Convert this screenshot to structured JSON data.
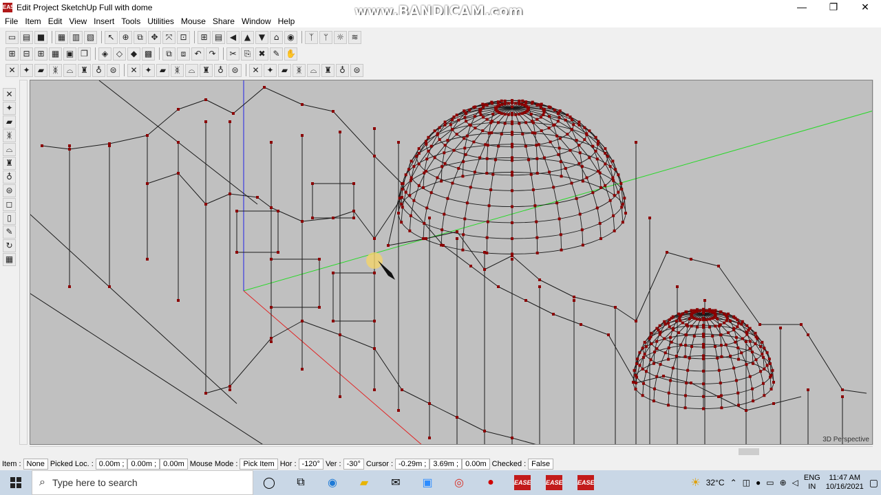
{
  "window": {
    "title": "Edit Project SketchUp Full with dome",
    "app_icon_text": "EASE"
  },
  "watermark": "www.BANDICAM.com",
  "controls": {
    "minimize": "—",
    "maximize": "❐",
    "close": "✕"
  },
  "menu": [
    "File",
    "Item",
    "Edit",
    "View",
    "Insert",
    "Tools",
    "Utilities",
    "Mouse",
    "Share",
    "Window",
    "Help"
  ],
  "viewport": {
    "label": "3D Perspective",
    "background": "#c0c0c0",
    "wire_color": "#1a1a1a",
    "point_color": "#8b0000"
  },
  "status": {
    "item_label": "Item :",
    "item_value": "None",
    "picked_label": "Picked Loc. :",
    "picked_x": "0.00m ;",
    "picked_y": "0.00m ;",
    "picked_z": "0.00m",
    "mouse_label": "Mouse Mode :",
    "mouse_value": "Pick Item",
    "hor_label": "Hor :",
    "hor_value": "-120°",
    "ver_label": "Ver :",
    "ver_value": "-30°",
    "cursor_label": "Cursor :",
    "cursor_x": "-0.29m ;",
    "cursor_y": "3.69m ;",
    "cursor_z": "0.00m",
    "checked_label": "Checked :",
    "checked_value": "False"
  },
  "taskbar": {
    "search_placeholder": "Type here to search",
    "ease_label": "EASE",
    "weather": "32°C",
    "lang_top": "ENG",
    "lang_bottom": "IN",
    "time": "11:47 AM",
    "date": "10/16/2021"
  }
}
